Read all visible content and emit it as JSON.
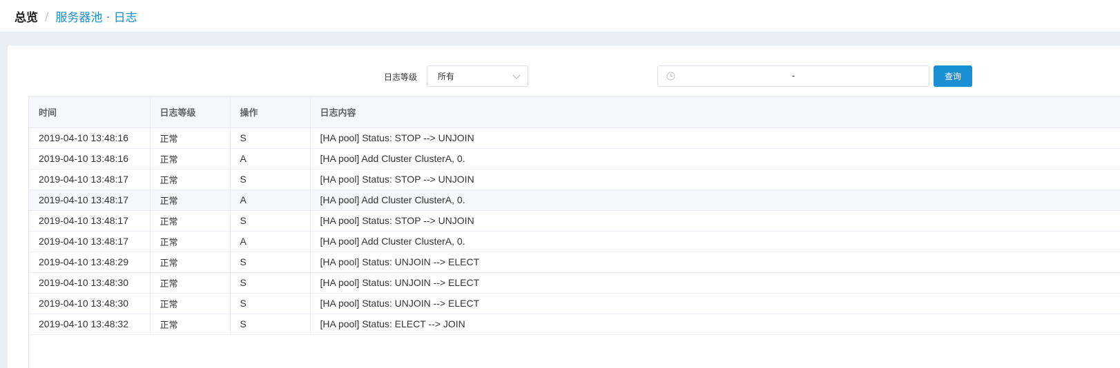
{
  "breadcrumb": {
    "root": "总览",
    "separator": "/",
    "current": "服务器池 · 日志"
  },
  "filters": {
    "level_label": "日志等级",
    "level_selected": "所有",
    "date_range_separator": "-",
    "query_label": "查询"
  },
  "table": {
    "columns": [
      "时间",
      "日志等级",
      "操作",
      "日志内容"
    ],
    "rows": [
      [
        "2019-04-10 13:48:16",
        "正常",
        "S",
        "[HA pool] Status: STOP --> UNJOIN"
      ],
      [
        "2019-04-10 13:48:16",
        "正常",
        "A",
        "[HA pool] Add Cluster ClusterA, 0."
      ],
      [
        "2019-04-10 13:48:17",
        "正常",
        "S",
        "[HA pool] Status: STOP --> UNJOIN"
      ],
      [
        "2019-04-10 13:48:17",
        "正常",
        "A",
        "[HA pool] Add Cluster ClusterA, 0."
      ],
      [
        "2019-04-10 13:48:17",
        "正常",
        "S",
        "[HA pool] Status: STOP --> UNJOIN"
      ],
      [
        "2019-04-10 13:48:17",
        "正常",
        "A",
        "[HA pool] Add Cluster ClusterA, 0."
      ],
      [
        "2019-04-10 13:48:29",
        "正常",
        "S",
        "[HA pool] Status: UNJOIN --> ELECT"
      ],
      [
        "2019-04-10 13:48:30",
        "正常",
        "S",
        "[HA pool] Status: UNJOIN --> ELECT"
      ],
      [
        "2019-04-10 13:48:30",
        "正常",
        "S",
        "[HA pool] Status: UNJOIN --> ELECT"
      ],
      [
        "2019-04-10 13:48:32",
        "正常",
        "S",
        "[HA pool] Status: ELECT --> JOIN"
      ]
    ],
    "hovered_row": 3
  },
  "colors": {
    "accent": "#1a8fd4",
    "breadcrumb_link": "#1a8fc9",
    "background": "#e9eef2"
  },
  "icons": {
    "date_range": "clock-icon",
    "select": "chevron-down-icon"
  }
}
